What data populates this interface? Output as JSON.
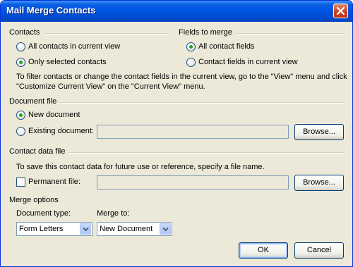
{
  "window": {
    "title": "Mail Merge Contacts"
  },
  "contacts": {
    "heading": "Contacts",
    "options": [
      "All contacts in current view",
      "Only selected contacts"
    ],
    "selected_index": 1
  },
  "fields": {
    "heading": "Fields to merge",
    "options": [
      "All contact fields",
      "Contact fields in current view"
    ],
    "selected_index": 0
  },
  "filter_note_line1": "To filter contacts or change the contact fields in the current view, go to the \"View\" menu and click",
  "filter_note_line2": "\"Customize Current View\" on the \"Current View\" menu.",
  "document_file": {
    "heading": "Document file",
    "new_document": "New document",
    "existing_document": "Existing document:",
    "existing_path": "",
    "browse": "Browse...",
    "selected": "new"
  },
  "contact_data_file": {
    "heading": "Contact data file",
    "note": "To save this contact data for future use or reference, specify a file name.",
    "permanent_file": "Permanent file:",
    "permanent_checked": false,
    "path": "",
    "browse": "Browse..."
  },
  "merge_options": {
    "heading": "Merge options",
    "document_type_label": "Document type:",
    "document_type_value": "Form Letters",
    "merge_to_label": "Merge to:",
    "merge_to_value": "New Document"
  },
  "buttons": {
    "ok": "OK",
    "cancel": "Cancel"
  },
  "colors": {
    "titlebar": "#0055E5",
    "dialog_bg": "#ECE9D8",
    "radio_dot": "#21A121"
  }
}
